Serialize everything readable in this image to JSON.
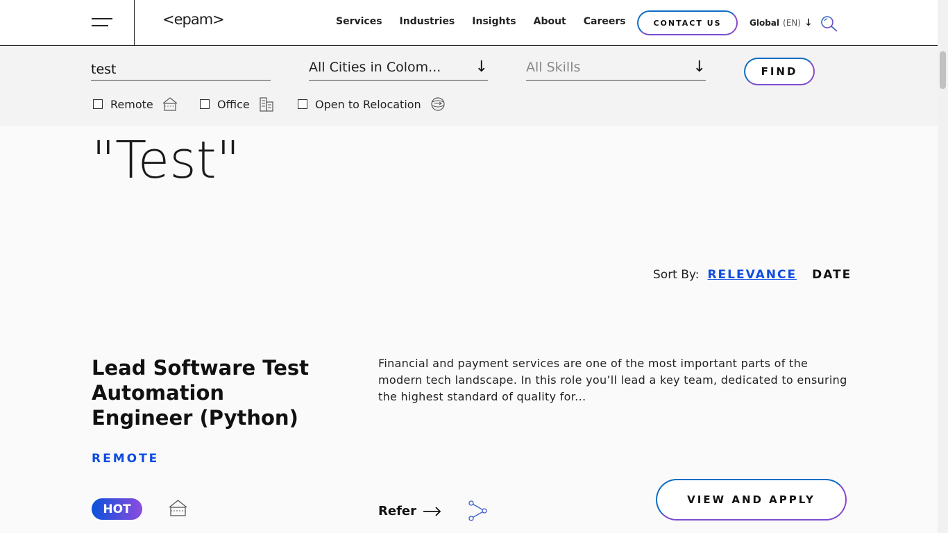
{
  "header": {
    "logo": "<epam>",
    "nav": [
      "Services",
      "Industries",
      "Insights",
      "About",
      "Careers"
    ],
    "contact_label": "CONTACT US",
    "lang_region": "Global",
    "lang_code": "(EN)"
  },
  "page": {
    "heading_line2": "\"Test\""
  },
  "filters": {
    "keyword_value": "test",
    "city_value": "All Cities in Colom...",
    "skills_placeholder": "All Skills",
    "find_label": "FIND",
    "checkboxes": [
      "Remote",
      "Office",
      "Open to Relocation"
    ]
  },
  "sort": {
    "label": "Sort By:",
    "relevance": "RELEVANCE",
    "date": "DATE"
  },
  "job": {
    "title": "Lead Software Test Automation Engineer (Python)",
    "location": "REMOTE",
    "badge": "HOT",
    "description": "Financial and payment services are one of the most important parts of the modern tech landscape. In this role you’ll lead a key team, dedicated to ensuring the highest standard of quality for...",
    "refer_label": "Refer",
    "apply_label": "VIEW AND APPLY"
  },
  "colors": {
    "accent_blue": "#0f4ce0",
    "gradient_start": "#0a52d9",
    "gradient_end": "#8d4be0"
  }
}
